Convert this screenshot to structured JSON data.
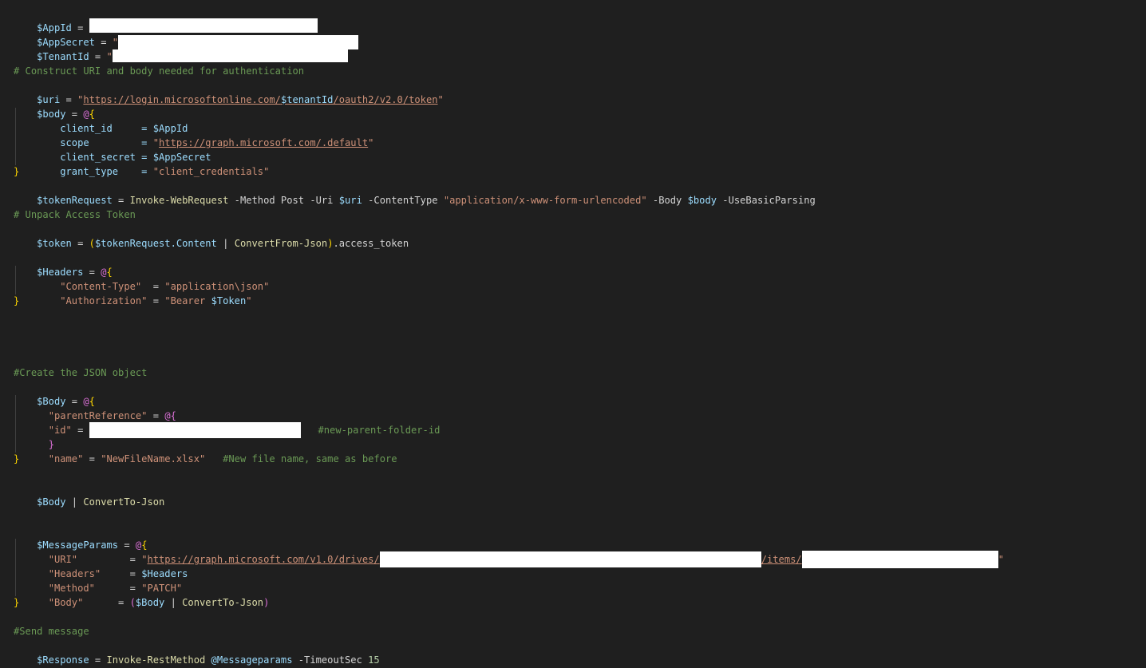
{
  "editor": {
    "language": "powershell",
    "colors": {
      "background": "#1f1f1f",
      "variable": "#9cdcfe",
      "string": "#ce9178",
      "comment": "#6a9955",
      "function": "#dcdcaa",
      "number": "#b5cea8",
      "bracket_level1": "#ffd700",
      "bracket_level2": "#da70d6",
      "redaction": "#ffffff"
    },
    "code": {
      "appid_var": "$AppId",
      "appid_eq": " = ",
      "appsecret_var": "$AppSecret",
      "appsecret_eq": " = ",
      "appsecret_quote": "\"",
      "tenantid_var": "$TenantId",
      "tenantid_eq": " = ",
      "tenantid_quote": "\"",
      "comment_construct": "# Construct URI and body needed for authentication",
      "uri_var": "$uri",
      "uri_eq": " = ",
      "uri_q1": "\"",
      "uri_url1": "https://login.microsoftonline.com/",
      "uri_tenant": "$tenantId",
      "uri_url2": "/oauth2/v2.0/token",
      "uri_q2": "\"",
      "body_var": "$body",
      "body_eq": " = ",
      "body_at": "@",
      "body_open": "{",
      "client_id_key": "    client_id     = ",
      "client_id_val": "$AppId",
      "scope_key": "    scope         = ",
      "scope_q1": "\"",
      "scope_url": "https://graph.microsoft.com/.default",
      "scope_q2": "\"",
      "client_secret_key": "    client_secret = ",
      "client_secret_val": "$AppSecret",
      "grant_type_key": "    grant_type    = ",
      "grant_type_val": "\"client_credentials\"",
      "body_close": "}",
      "tokreq_var": "$tokenRequest",
      "tokreq_eq": " = ",
      "tokreq_cmd": "Invoke-WebRequest",
      "tokreq_p1": " -Method Post -Uri ",
      "tokreq_uri": "$uri",
      "tokreq_p2": " -ContentType ",
      "tokreq_ct": "\"application/x-www-form-urlencoded\"",
      "tokreq_p3": " -Body ",
      "tokreq_body": "$body",
      "tokreq_p4": " -UseBasicParsing",
      "comment_unpack": "# Unpack Access Token",
      "token_var": "$token",
      "token_eq": " = ",
      "token_paren_open": "(",
      "token_req": "$tokenRequest",
      "token_content": ".Content",
      "token_pipe": " | ",
      "token_cmd": "ConvertFrom-Json",
      "token_paren_close": ")",
      "token_prop": ".access_token",
      "headers_var": "$Headers",
      "headers_eq": " = ",
      "headers_at": "@",
      "headers_open": "{",
      "ct_key": "\"Content-Type\"",
      "ct_eq": "  = ",
      "ct_val": "\"application\\json\"",
      "auth_key": "\"Authorization\"",
      "auth_eq": " = ",
      "auth_val1": "\"Bearer ",
      "auth_tok": "$Token",
      "auth_val2": "\"",
      "headers_close": "}",
      "comment_create": "#Create the JSON object",
      "Body_var": "$Body",
      "Body_eq": " = ",
      "Body_at": "@",
      "Body_open": "{",
      "parentref_key": "\"parentReference\"",
      "parentref_eq": " = ",
      "parentref_at": "@",
      "parentref_open": "{",
      "id_key": "\"id\"",
      "id_eq": " = ",
      "id_comment": "#new-parent-folder-id",
      "parentref_close": "}",
      "name_key": "\"name\"",
      "name_eq": " = ",
      "name_val": "\"NewFileName.xlsx\"",
      "name_comment": "#New file name, same as before",
      "Body_close": "}",
      "conv_var": "$Body",
      "conv_pipe": " | ",
      "conv_cmd": "ConvertTo-Json",
      "msg_var": "$MessageParams",
      "msg_eq": " = ",
      "msg_at": "@",
      "msg_open": "{",
      "uri_key": "\"URI\"",
      "uri_key_eq": "         = ",
      "uri_val_q": "\"",
      "uri_val_url1": "https://graph.microsoft.com/v1.0/drives/",
      "uri_val_url2": "/items/",
      "uri_val_q2": "\"",
      "hdr_key": "\"Headers\"",
      "hdr_eq": "     = ",
      "hdr_val": "$Headers",
      "method_key": "\"Method\"",
      "method_eq": "      = ",
      "method_val": "\"PATCH\"",
      "bodyk_key": "\"Body\"",
      "bodyk_eq": "      = ",
      "bodyk_open": "(",
      "bodyk_var": "$Body",
      "bodyk_pipe": " | ",
      "bodyk_cmd": "ConvertTo-Json",
      "bodyk_close": ")",
      "msg_close": "}",
      "comment_send": "#Send message",
      "resp_var": "$Response",
      "resp_eq": " = ",
      "resp_cmd": "Invoke-RestMethod",
      "resp_splat": " @Messageparams",
      "resp_p1": " -TimeoutSec ",
      "resp_num": "15"
    }
  }
}
